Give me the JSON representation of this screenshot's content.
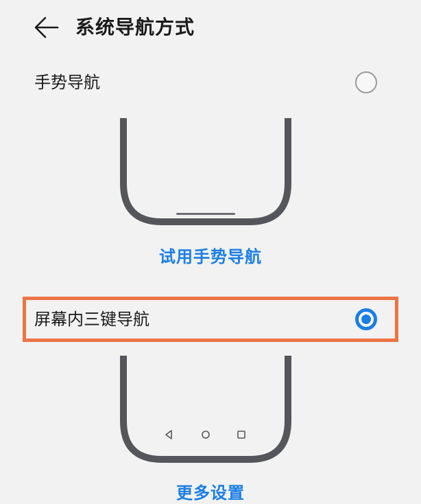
{
  "header": {
    "title": "系统导航方式",
    "back_icon": "arrow-left-icon"
  },
  "options": [
    {
      "label": "手势导航",
      "selected": false,
      "action_label": "试用手势导航"
    },
    {
      "label": "屏幕内三键导航",
      "selected": true,
      "action_label": "更多设置",
      "nav_buttons": [
        "back-triangle-icon",
        "home-circle-icon",
        "recents-square-icon"
      ]
    }
  ],
  "colors": {
    "accent": "#1a7ee6",
    "highlight": "#ec7445",
    "background": "#f2f2f2",
    "phone_frame": "#55565b"
  }
}
